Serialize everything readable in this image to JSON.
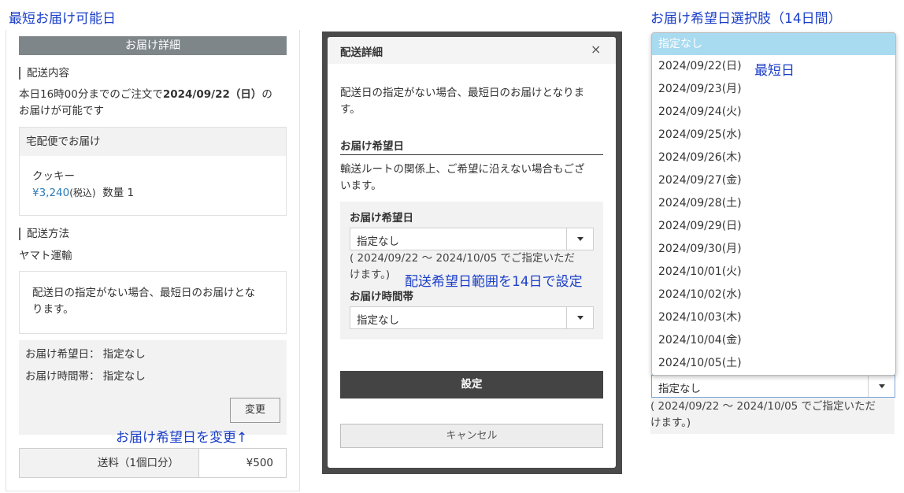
{
  "annotations": {
    "shortest_date_title": "最短お届け可能日",
    "options_title": "お届け希望日選択肢（14日間）",
    "change_hint": "お届け希望日を変更↑",
    "range_note": "配送希望日範囲を14日で設定",
    "shortest_marker": "最短日"
  },
  "panel1": {
    "header": "お届け詳細",
    "delivery_contents_label": "配送内容",
    "order_notice_1": "本日16時00分までのご注文で",
    "order_notice_date": "2024/09/22（日）",
    "order_notice_2": "の",
    "order_notice_3": "お届けが可能です",
    "courier_box_title": "宅配便でお届け",
    "item_name": "クッキー",
    "item_price": "¥3,240",
    "item_tax": "(税込)",
    "item_qty": "数量 1",
    "delivery_method_label": "配送方法",
    "carrier": "ヤマト運輸",
    "no_date_notice_1": "配送日の指定がない場合、最短日のお届けとな",
    "no_date_notice_2": "ります。",
    "desired_date_label": "お届け希望日：",
    "desired_date_value": "指定なし",
    "time_slot_label": "お届け時間帯：",
    "time_slot_value": "指定なし",
    "change_button": "変更",
    "shipping_label": "送料（1個口分）",
    "shipping_value": "¥500"
  },
  "panel2": {
    "title": "配送詳細",
    "close": "×",
    "notice_1": "配送日の指定がない場合、最短日のお届けとなりま",
    "notice_2": "す。",
    "desired_date_heading": "お届け希望日",
    "route_notice_1": "輸送ルートの関係上、ご希望に沿えない場合もござ",
    "route_notice_2": "います。",
    "date_field_label": "お届け希望日",
    "date_select_value": "指定なし",
    "range_text_1": "( 2024/09/22 〜 2024/10/05 でご指定いただ",
    "range_text_2": "けます。)",
    "time_field_label": "お届け時間帯",
    "time_select_value": "指定なし",
    "set_button": "設定",
    "cancel_button": "キャンセル"
  },
  "panel3": {
    "options": [
      "指定なし",
      "2024/09/22(日)",
      "2024/09/23(月)",
      "2024/09/24(火)",
      "2024/09/25(水)",
      "2024/09/26(木)",
      "2024/09/27(金)",
      "2024/09/28(土)",
      "2024/09/29(日)",
      "2024/09/30(月)",
      "2024/10/01(火)",
      "2024/10/02(水)",
      "2024/10/03(木)",
      "2024/10/04(金)",
      "2024/10/05(土)"
    ],
    "select_value": "指定なし",
    "range_text_1": "( 2024/09/22 〜 2024/10/05 でご指定いただ",
    "range_text_2": "けます。)"
  },
  "colors": {
    "annotation": "#1a3ec8",
    "header_gray": "#7e868a",
    "price_blue": "#2a7bb8",
    "set_button": "#444444",
    "highlight": "#a8daf0"
  }
}
